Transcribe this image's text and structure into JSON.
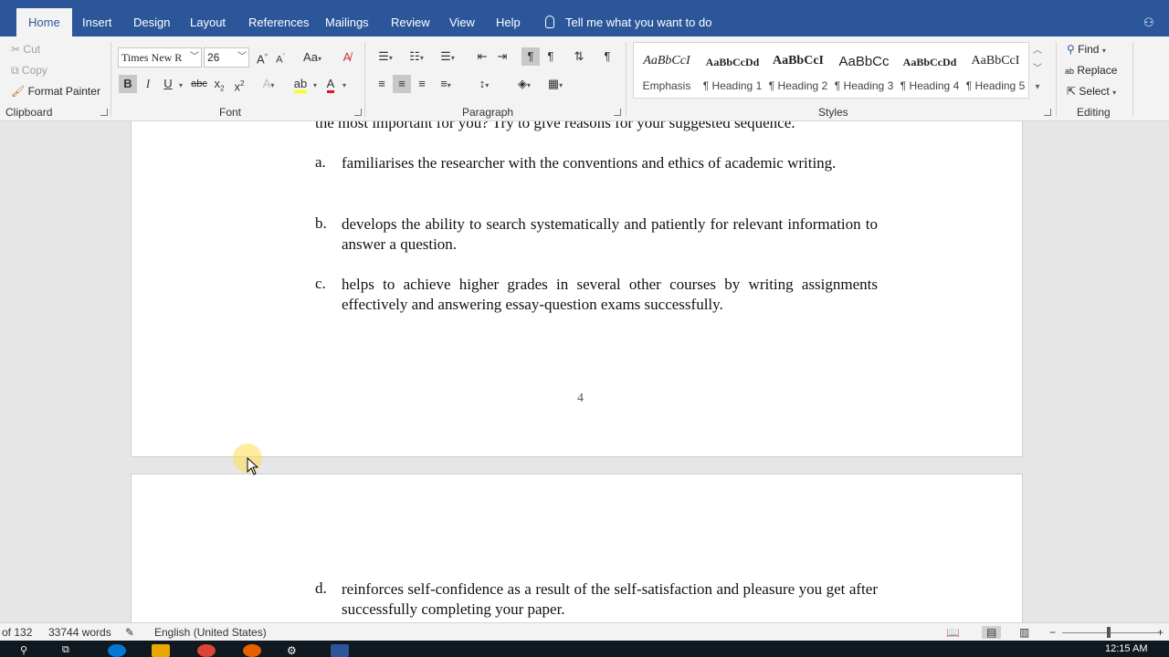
{
  "tabs": [
    "Home",
    "Insert",
    "Design",
    "Layout",
    "References",
    "Mailings",
    "Review",
    "View",
    "Help"
  ],
  "tell_me": "Tell me what you want to do",
  "share": "Sh",
  "clipboard": {
    "cut": "Cut",
    "copy": "Copy",
    "format_painter": "Format Painter",
    "label": "Clipboard"
  },
  "font": {
    "name": "Times New R",
    "size": "26",
    "label": "Font"
  },
  "paragraph": {
    "label": "Paragraph"
  },
  "styles": {
    "label": "Styles",
    "items": [
      {
        "sample": "AaBbCcI",
        "name": "Emphasis"
      },
      {
        "sample": "AaBbCcDd",
        "name": "¶ Heading 1"
      },
      {
        "sample": "AaBbCcI",
        "name": "¶ Heading 2"
      },
      {
        "sample": "AaBbCc",
        "name": "¶ Heading 3"
      },
      {
        "sample": "AaBbCcDd",
        "name": "¶ Heading 4"
      },
      {
        "sample": "AaBbCcI",
        "name": "¶ Heading 5"
      }
    ]
  },
  "editing": {
    "find": "Find",
    "replace": "Replace",
    "select": "Select",
    "label": "Editing"
  },
  "document": {
    "intro_line": "the most important for you? Try to give reasons for your suggested sequence.",
    "items": [
      {
        "letter": "a.",
        "text": "familiarises the researcher with the conventions and ethics of academic writing."
      },
      {
        "letter": "b.",
        "text": "develops the ability to search systematically and patiently for relevant information to answer a question."
      },
      {
        "letter": "c.",
        "text": "helps to achieve higher grades in several other courses by writing assignments effectively and answering essay-question exams successfully."
      }
    ],
    "page_number": "4",
    "page2_item": {
      "letter": "d.",
      "text": "reinforces self-confidence as a result of the self-satisfaction and pleasure you get after successfully completing your paper."
    }
  },
  "status": {
    "pages": "of 132",
    "words": "33744 words",
    "language": "English (United States)"
  },
  "clock": "12:15 AM",
  "colors": {
    "accent": "#2b579a",
    "highlight": "#ffff00",
    "font_color": "#e81123"
  }
}
